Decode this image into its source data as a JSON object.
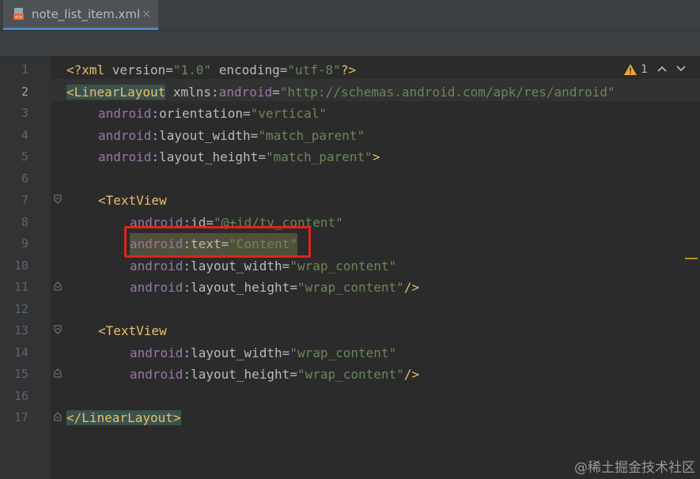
{
  "tab": {
    "filename": "note_list_item.xml",
    "icon": "xml-file-icon",
    "close": "×"
  },
  "inspection": {
    "warning_count": "1",
    "icon": "warning-icon",
    "up": "⌃",
    "down": "⌄"
  },
  "line_numbers": [
    "1",
    "2",
    "3",
    "4",
    "5",
    "6",
    "7",
    "8",
    "9",
    "10",
    "11",
    "12",
    "13",
    "14",
    "15",
    "16",
    "17"
  ],
  "code": {
    "l1": {
      "open": "<?xml ",
      "version_attr": "version",
      "eq1": "=",
      "version_val": "\"1.0\"",
      "sp": " ",
      "enc_attr": "encoding",
      "eq2": "=",
      "enc_val": "\"utf-8\"",
      "close": "?>"
    },
    "l2": {
      "tag": "<LinearLayout",
      "sp": " ",
      "xmlns": "xmlns",
      "colon": ":",
      "ns": "android",
      "eq": "=",
      "val": "\"http://schemas.android.com/apk/res/android\""
    },
    "l3": {
      "ns": "android",
      "colon": ":",
      "name": "orientation",
      "eq": "=",
      "val": "\"vertical\""
    },
    "l4": {
      "ns": "android",
      "colon": ":",
      "name": "layout_width",
      "eq": "=",
      "val": "\"match_parent\""
    },
    "l5": {
      "ns": "android",
      "colon": ":",
      "name": "layout_height",
      "eq": "=",
      "val": "\"match_parent\"",
      "close": ">"
    },
    "l7": {
      "tag": "<TextView"
    },
    "l8": {
      "ns": "android",
      "colon": ":",
      "name": "id",
      "eq": "=",
      "val": "\"@+id/tv_content\""
    },
    "l9": {
      "ns": "android",
      "colon": ":",
      "name": "text",
      "eq": "=",
      "val": "\"Content\""
    },
    "l10": {
      "ns": "android",
      "colon": ":",
      "name": "layout_width",
      "eq": "=",
      "val": "\"wrap_content\""
    },
    "l11": {
      "ns": "android",
      "colon": ":",
      "name": "layout_height",
      "eq": "=",
      "val": "\"wrap_content\"",
      "close": "/>"
    },
    "l13": {
      "tag": "<TextView"
    },
    "l14": {
      "ns": "android",
      "colon": ":",
      "name": "layout_width",
      "eq": "=",
      "val": "\"wrap_content\""
    },
    "l15": {
      "ns": "android",
      "colon": ":",
      "name": "layout_height",
      "eq": "=",
      "val": "\"wrap_content\"",
      "close": "/>"
    },
    "l17": {
      "tag": "</LinearLayout>"
    }
  },
  "watermark": "@稀土掘金技术社区",
  "colors": {
    "tag": "#e8bf6a",
    "attr": "#9876aa",
    "value": "#6a8759",
    "highlight_border": "#e0241b"
  }
}
